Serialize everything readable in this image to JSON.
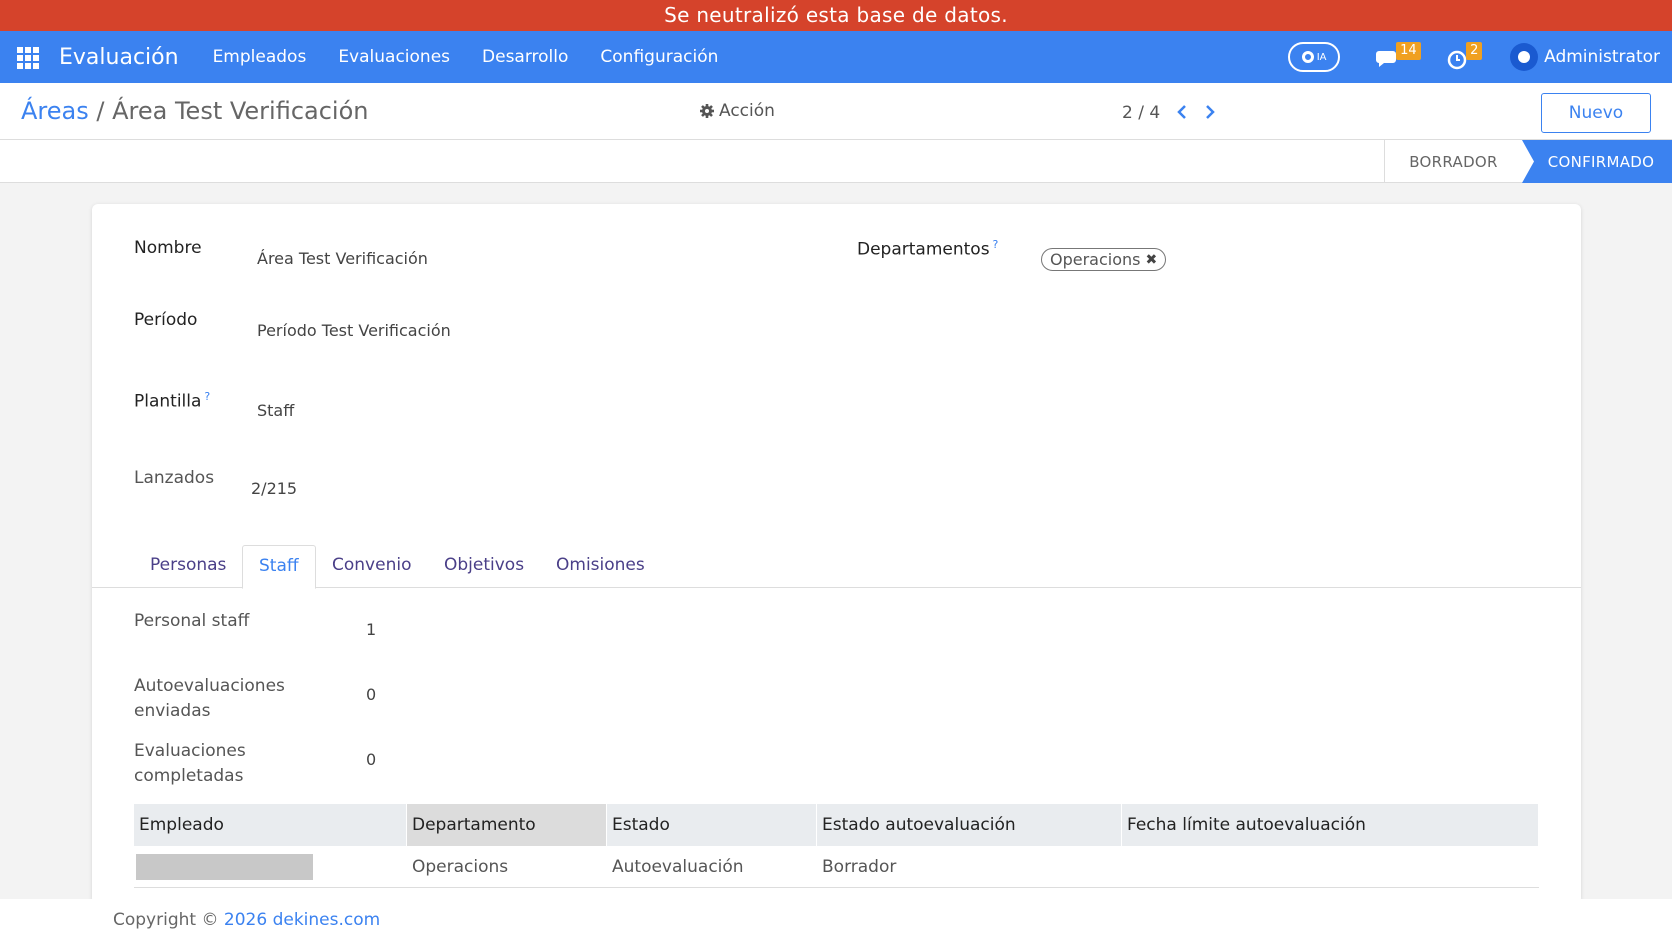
{
  "banner": {
    "text": "Se neutralizó esta base de datos."
  },
  "navbar": {
    "brand": "Evaluación",
    "menu": [
      "Empleados",
      "Evaluaciones",
      "Desarrollo",
      "Configuración"
    ],
    "ia_label": "IA",
    "messages_count": "14",
    "activities_count": "2",
    "user": "Administrator"
  },
  "control_panel": {
    "breadcrumb_parent": "Áreas",
    "breadcrumb_sep": "/",
    "breadcrumb_current": "Área Test Verificación",
    "action_label": "Acción",
    "pager": "2 / 4",
    "new_label": "Nuevo"
  },
  "status": {
    "draft": "BORRADOR",
    "confirmed": "CONFIRMADO",
    "current": "CONFIRMADO"
  },
  "form": {
    "nombre_label": "Nombre",
    "nombre_value": "Área Test Verificación",
    "periodo_label": "Período",
    "periodo_value": "Período Test Verificación",
    "plantilla_label": "Plantilla",
    "plantilla_value": "Staff",
    "lanzados_label": "Lanzados",
    "lanzados_value": "2/215",
    "departamentos_label": "Departamentos",
    "departamentos_tags": [
      "Operacions"
    ],
    "help_mark": "?"
  },
  "tabs": {
    "items": [
      "Personas",
      "Staff",
      "Convenio",
      "Objetivos",
      "Omisiones"
    ],
    "active": "Staff"
  },
  "staff": {
    "personal_label": "Personal staff",
    "personal_value": "1",
    "auto_label_1": "Autoevaluaciones",
    "auto_label_2": "enviadas",
    "auto_value": "0",
    "comp_label_1": "Evaluaciones",
    "comp_label_2": "completadas",
    "comp_value": "0"
  },
  "table": {
    "columns": [
      "Empleado",
      "Departamento",
      "Estado",
      "Estado autoevaluación",
      "Fecha límite autoevaluación"
    ],
    "rows": [
      {
        "empleado": "",
        "departamento": "Operacions",
        "estado": "Autoevaluación",
        "estado_auto": "Borrador",
        "fecha": ""
      }
    ]
  },
  "footer": {
    "copyright": "Copyright ©",
    "year": "2026",
    "site": "dekines.com"
  }
}
